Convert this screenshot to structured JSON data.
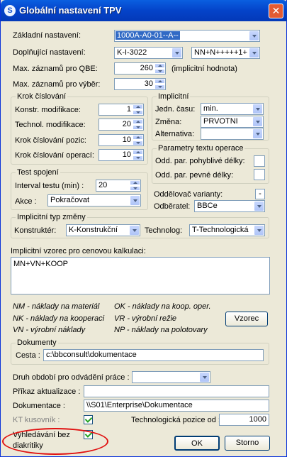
{
  "window": {
    "title": "Globální nastavení TPV",
    "app_icon": "S"
  },
  "basic": {
    "zakladni_label": "Základní nastavení:",
    "zakladni_value": "1000A-A0-01--A--",
    "doplnujici_label": "Doplňující nastavení:",
    "doplnujici_value1": "K-I-3022",
    "doplnujici_value2": "NN+N+++++1+",
    "max_qbe_label": "Max. záznamů pro QBE:",
    "max_qbe_value": "260",
    "max_qbe_note": "(implicitní hodnota)",
    "max_vyber_label": "Max. záznamů pro výběr:",
    "max_vyber_value": "30"
  },
  "krok": {
    "title": "Krok číslování",
    "konstr_label": "Konstr. modifikace:",
    "konstr_value": "1",
    "technol_label": "Technol. modifikace:",
    "technol_value": "20",
    "pozic_label": "Krok číslování pozic:",
    "pozic_value": "10",
    "operaci_label": "Krok číslování operací:",
    "operaci_value": "10"
  },
  "implicitni": {
    "title": "Implicitní",
    "jedn_label": "Jedn. času:",
    "jedn_value": "min.",
    "zmena_label": "Změna:",
    "zmena_value": "PRVOTNI",
    "alternativa_label": "Alternativa:",
    "alternativa_value": ""
  },
  "parametry": {
    "title": "Parametry textu operace",
    "pohyblive_label": "Odd. par. pohyblivé délky:",
    "pevne_label": "Odd. par. pevné délky:"
  },
  "test": {
    "title": "Test spojení",
    "interval_label": "Interval testu (min) :",
    "interval_value": "20",
    "akce_label": "Akce :",
    "akce_value": "Pokračovat"
  },
  "oddelovac": {
    "label": "Oddělovač varianty:",
    "value": "-"
  },
  "odberatel": {
    "label": "Odběratel:",
    "value": "BBCe"
  },
  "typ_zmeny": {
    "title": "Implicitní typ změny",
    "konstrukter_label": "Konstruktér:",
    "konstrukter_value": "K-Konstrukční",
    "technolog_label": "Technolog:",
    "technolog_value": "T-Technologická"
  },
  "vzorec": {
    "label": "Implicitní vzorec pro cenovou kalkulaci:",
    "value": "MN+VN+KOOP",
    "legend": [
      "NM - náklady na materiál",
      "OK - náklady na koop. oper.",
      "NK - náklady na kooperaci",
      "VR - výrobní režie",
      "VN - výrobní náklady",
      "NP - náklady na polotovary"
    ],
    "button": "Vzorec"
  },
  "dokumenty": {
    "title": "Dokumenty",
    "cesta_label": "Cesta :",
    "cesta_value": "c:\\bbconsult\\dokumentace"
  },
  "bottom": {
    "druh_label": "Druh období pro odvádění práce :",
    "druh_value": "",
    "prikaz_label": "Příkaz aktualizace :",
    "prikaz_value": "",
    "dokumentace_label": "Dokumentace :",
    "dokumentace_value": "\\\\S01\\Enterprise\\Dokumentace",
    "kt_label": "KT kusovník :",
    "pozice_label": "Technologická pozice od :",
    "pozice_value": "1000",
    "vyhledavani_label1": "Vyhledávání bez",
    "vyhledavani_label2": "diakritiky"
  },
  "buttons": {
    "ok": "OK",
    "storno": "Storno"
  },
  "colors": {
    "highlight": "#e01010",
    "title_bar": "#0443c9",
    "selection": "#316ac5"
  }
}
